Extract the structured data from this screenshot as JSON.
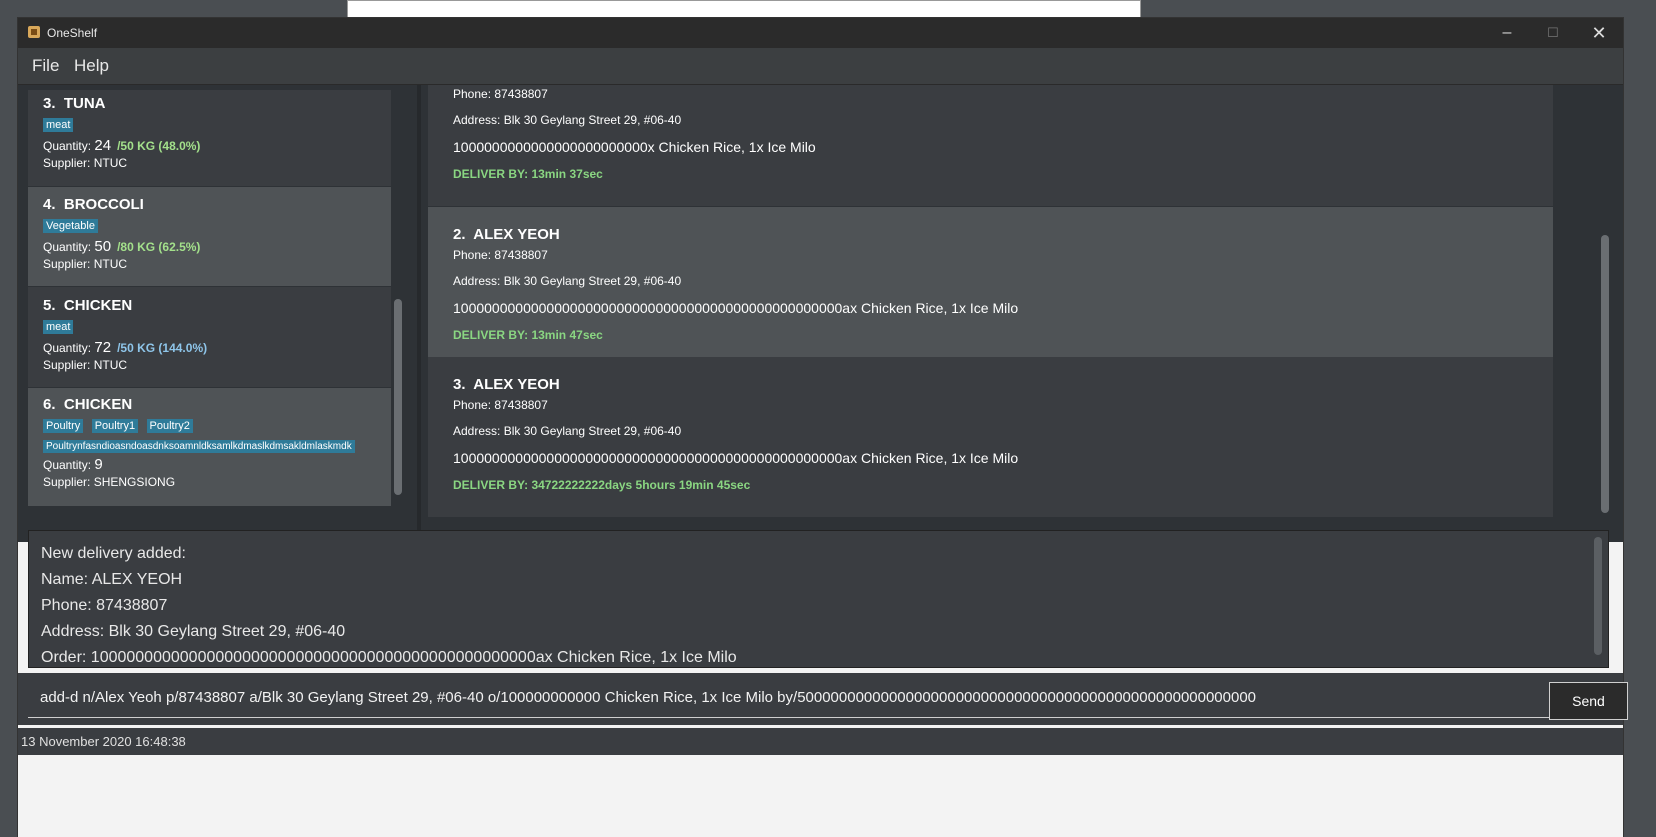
{
  "window": {
    "title": "OneShelf"
  },
  "menu": {
    "file": "File",
    "help": "Help"
  },
  "inventory": [
    {
      "index": "3.",
      "name": "TUNA",
      "tags": [
        "meat"
      ],
      "quantity_label": "Quantity:",
      "quantity": "24",
      "ratio": "/50 KG (48.0%)",
      "ratio_color": "#a3e08b",
      "supplier": "Supplier: NTUC"
    },
    {
      "index": "4.",
      "name": "BROCCOLI",
      "tags": [
        "Vegetable"
      ],
      "quantity_label": "Quantity:",
      "quantity": "50",
      "ratio": "/80 KG (62.5%)",
      "ratio_color": "#a3e08b",
      "supplier": "Supplier: NTUC"
    },
    {
      "index": "5.",
      "name": "CHICKEN",
      "tags": [
        "meat"
      ],
      "quantity_label": "Quantity:",
      "quantity": "72",
      "ratio": "/50 KG (144.0%)",
      "ratio_color": "#8ec5e9",
      "supplier": "Supplier: NTUC"
    },
    {
      "index": "6.",
      "name": "CHICKEN",
      "tags": [
        "Poultry",
        "Poultry1",
        "Poultry2",
        "Poultrynfasndioasndoasdnksoamnldksamlkdmaslkdmsakldmlaskmdk"
      ],
      "quantity_label": "Quantity:",
      "quantity": "9",
      "ratio": "",
      "ratio_color": "#a3e08b",
      "supplier": "Supplier: SHENGSIONG"
    }
  ],
  "deliveries": [
    {
      "index": "",
      "name": "",
      "phone": "Phone: 87438807",
      "address": "Address: Blk 30 Geylang Street 29, #06-40",
      "order": "1000000000000000000000000x Chicken Rice, 1x Ice Milo",
      "deadline": "DELIVER BY: 13min 37sec"
    },
    {
      "index": "2.",
      "name": "ALEX YEOH",
      "phone": "Phone: 87438807",
      "address": "Address: Blk 30 Geylang Street 29, #06-40",
      "order": "10000000000000000000000000000000000000000000000000ax Chicken Rice, 1x Ice Milo",
      "deadline": "DELIVER BY: 13min 47sec"
    },
    {
      "index": "3.",
      "name": "ALEX YEOH",
      "phone": "Phone: 87438807",
      "address": "Address: Blk 30 Geylang Street 29, #06-40",
      "order": "10000000000000000000000000000000000000000000000000ax Chicken Rice, 1x Ice Milo",
      "deadline": "DELIVER BY: 34722222222days 5hours 19min 45sec"
    }
  ],
  "result": {
    "lines": [
      "New delivery added:",
      "Name: ALEX YEOH",
      "Phone: 87438807",
      "Address: Blk 30 Geylang Street 29, #06-40",
      "Order: 10000000000000000000000000000000000000000000000000ax Chicken Rice, 1x Ice Milo"
    ]
  },
  "command": {
    "value": "add-d n/Alex Yeoh p/87438807 a/Blk 30 Geylang Street 29, #06-40 o/100000000000 Chicken Rice, 1x Ice Milo by/5000000000000000000000000000000000000000000000000000000",
    "send_label": "Send"
  },
  "status": {
    "timestamp": "13 November 2020 16:48:38"
  },
  "icons": {
    "app": "box-icon",
    "minimize": "minimize-icon",
    "maximize": "maximize-icon",
    "close": "close-icon"
  }
}
